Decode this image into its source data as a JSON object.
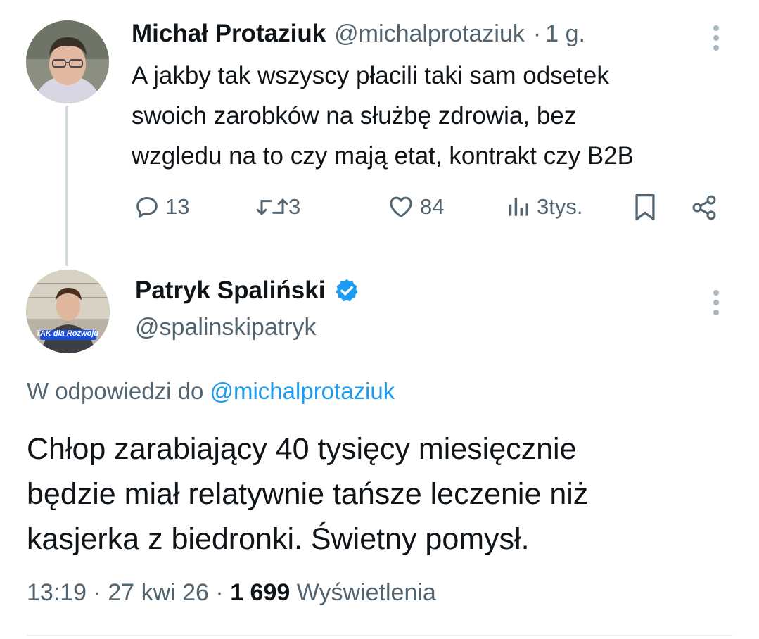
{
  "parent_tweet": {
    "author_name": "Michał Protaziuk",
    "handle": "@michalprotaziuk",
    "separator": "·",
    "time_ago": "1 g.",
    "text_lines": [
      "A jakby tak wszyscy płacili taki sam odsetek",
      "swoich zarobków na służbę zdrowia, bez",
      "wzgledu na to czy mają etat, kontrakt czy B2B"
    ],
    "actions": {
      "replies": "13",
      "reposts": "3",
      "likes": "84",
      "views": "3tys."
    },
    "icons": [
      "more-icon",
      "reply-icon",
      "repost-icon",
      "like-icon",
      "views-icon",
      "bookmark-icon",
      "share-icon"
    ]
  },
  "main_tweet": {
    "author_name": "Patryk Spaliński",
    "handle": "@spalinskipatryk",
    "verified": true,
    "avatar_caption": "TAK dla Rozwoju",
    "reply_to_prefix": "W odpowiedzi do",
    "reply_to_handle": "@michalprotaziuk",
    "text_lines": [
      "Chłop zarabiający 40 tysięcy miesięcznie",
      "będzie miał relatywnie tańsze leczenie niż",
      "kasjerka z biedronki. Świetny pomysł."
    ],
    "time": "13:19",
    "date": "27 kwi 26",
    "separator": "·",
    "views_count": "1 699",
    "views_label": "Wyświetlenia"
  },
  "colors": {
    "accent": "#1d9bf0",
    "text_primary": "#0f1419",
    "text_secondary": "#536471",
    "thread_line": "#cfd9de"
  }
}
